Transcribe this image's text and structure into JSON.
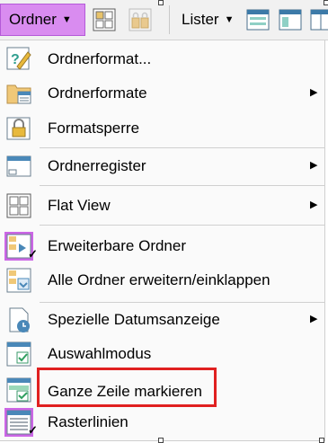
{
  "toolbar": {
    "ordner_label": "Ordner",
    "lister_label": "Lister",
    "icons": [
      "flat-view-icon",
      "folder-lock-icon",
      "lister-layout-icon",
      "lister-panes-icon",
      "lister-dual-icon"
    ],
    "active_color": "#d98cf0"
  },
  "menu": {
    "items": [
      {
        "label": "Ordnerformat...",
        "icon": "folder-format-edit-icon",
        "submenu": false,
        "checked": false
      },
      {
        "label": "Ordnerformate",
        "icon": "folder-formats-icon",
        "submenu": true,
        "checked": false
      },
      {
        "label": "Formatsperre",
        "icon": "format-lock-icon",
        "submenu": false,
        "checked": false
      },
      {
        "label": "Ordnerregister",
        "icon": "folder-tabs-icon",
        "submenu": true,
        "checked": false
      },
      {
        "label": "Flat View",
        "icon": "flat-view-icon",
        "submenu": true,
        "checked": false
      },
      {
        "label": "Erweiterbare Ordner",
        "icon": "expandable-folders-icon",
        "submenu": false,
        "checked": true
      },
      {
        "label": "Alle Ordner erweitern/einklappen",
        "icon": "expand-collapse-icon",
        "submenu": false,
        "checked": false
      },
      {
        "label": "Spezielle Datumsanzeige",
        "icon": "date-display-icon",
        "submenu": true,
        "checked": false
      },
      {
        "label": "Auswahlmodus",
        "icon": "selection-mode-icon",
        "submenu": false,
        "checked": false
      },
      {
        "label": "Ganze Zeile markieren",
        "icon": "full-row-select-icon",
        "submenu": false,
        "checked": false,
        "highlighted": true
      },
      {
        "label": "Rasterlinien",
        "icon": "grid-lines-icon",
        "submenu": false,
        "checked": true
      }
    ],
    "submenu_glyph": "▶",
    "checked_glyph": "✓",
    "highlight_color": "#e02020"
  }
}
